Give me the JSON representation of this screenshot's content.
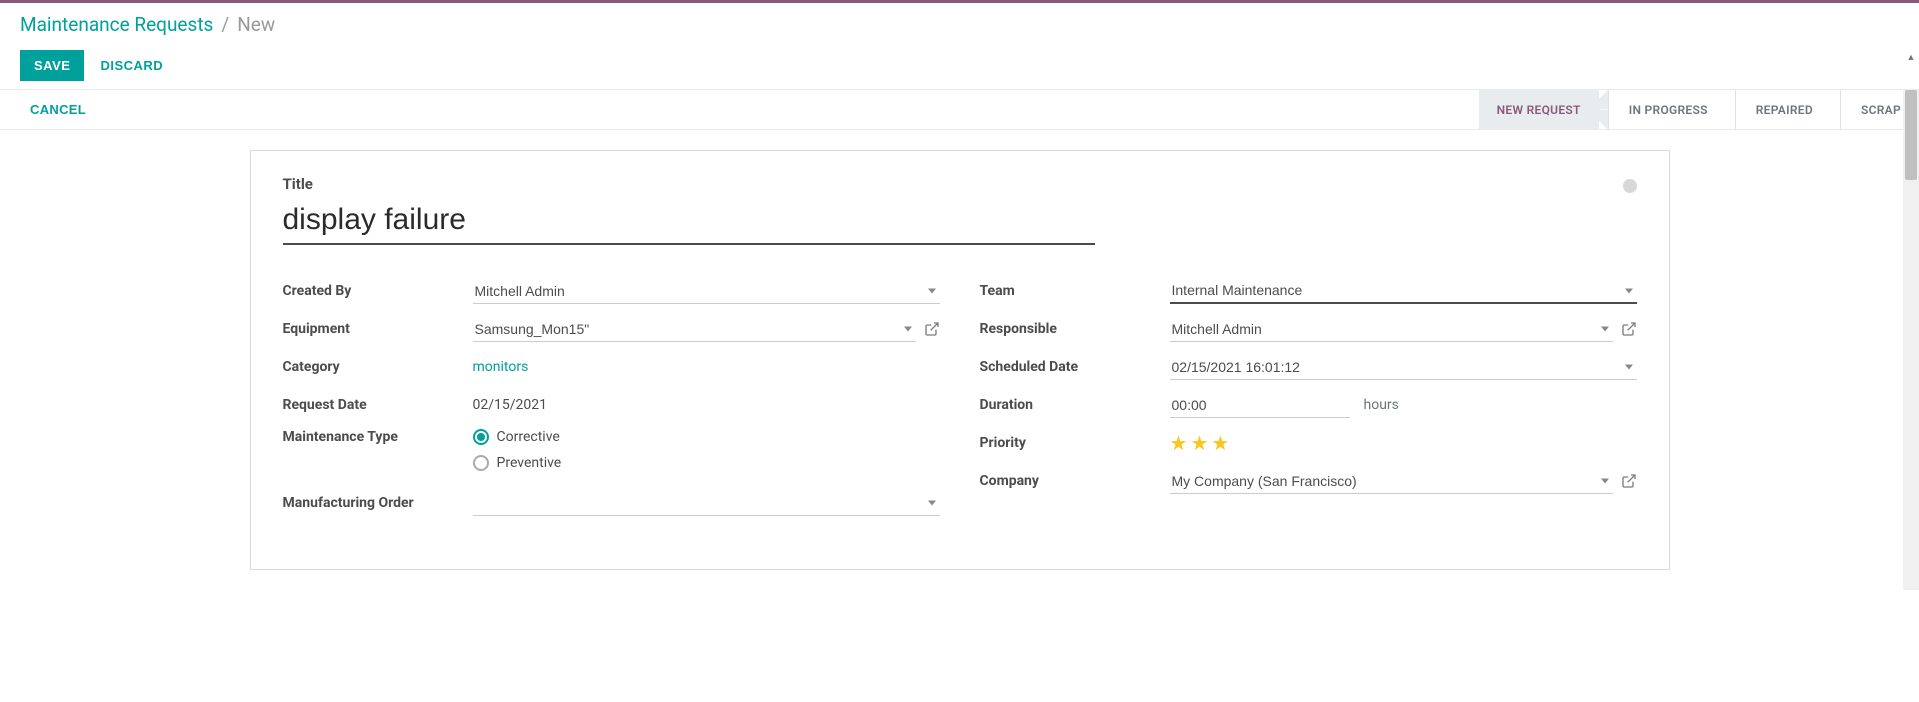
{
  "breadcrumb": {
    "parent": "Maintenance Requests",
    "current": "New"
  },
  "actions": {
    "save": "SAVE",
    "discard": "DISCARD",
    "cancel": "CANCEL"
  },
  "status_steps": {
    "s0": "NEW REQUEST",
    "s1": "IN PROGRESS",
    "s2": "REPAIRED",
    "s3": "SCRAP"
  },
  "labels": {
    "title": "Title",
    "created_by": "Created By",
    "equipment": "Equipment",
    "category": "Category",
    "request_date": "Request Date",
    "maintenance_type": "Maintenance Type",
    "manufacturing_order": "Manufacturing Order",
    "team": "Team",
    "responsible": "Responsible",
    "scheduled_date": "Scheduled Date",
    "duration": "Duration",
    "priority": "Priority",
    "company": "Company"
  },
  "values": {
    "title": "display failure",
    "created_by": "Mitchell Admin",
    "equipment": "Samsung_Mon15\"",
    "category": "monitors",
    "request_date": "02/15/2021",
    "maintenance_type_corrective": "Corrective",
    "maintenance_type_preventive": "Preventive",
    "manufacturing_order": "",
    "team": "Internal Maintenance",
    "responsible": "Mitchell Admin",
    "scheduled_date": "02/15/2021 16:01:12",
    "duration": "00:00",
    "duration_unit": "hours",
    "company": "My Company (San Francisco)",
    "priority_stars": 3
  }
}
